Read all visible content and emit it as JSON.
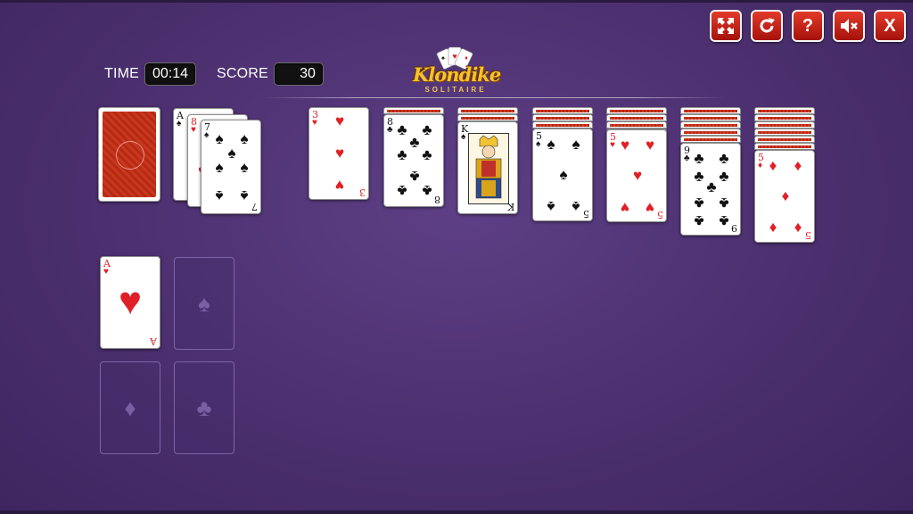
{
  "toolbar": {
    "buttons": [
      {
        "name": "fullscreen-button",
        "icon": "fullscreen-icon"
      },
      {
        "name": "restart-button",
        "icon": "restart-icon"
      },
      {
        "name": "help-button",
        "icon": "help-icon",
        "glyph": "?"
      },
      {
        "name": "mute-button",
        "icon": "sound-muted-icon"
      },
      {
        "name": "close-button",
        "icon": "close-icon",
        "glyph": "X"
      }
    ]
  },
  "hud": {
    "time_label": "TIME",
    "time_value": "00:14",
    "score_label": "SCORE",
    "score_value": "30"
  },
  "logo": {
    "title": "Klondike",
    "subtitle": "SOLITAIRE"
  },
  "stock": {
    "face_down": true
  },
  "waste": [
    {
      "rank": "A",
      "suit": "♠"
    },
    {
      "rank": "8",
      "suit": "♥"
    },
    {
      "rank": "7",
      "suit": "♠"
    }
  ],
  "tableau": [
    {
      "hidden": 0,
      "card": {
        "rank": "3",
        "suit": "♥"
      }
    },
    {
      "hidden": 1,
      "card": {
        "rank": "8",
        "suit": "♣"
      }
    },
    {
      "hidden": 2,
      "card": {
        "rank": "K",
        "suit": "♠"
      }
    },
    {
      "hidden": 3,
      "card": {
        "rank": "5",
        "suit": "♠"
      }
    },
    {
      "hidden": 4,
      "card": {
        "rank": "5",
        "suit": "♥"
      }
    },
    {
      "hidden": 5,
      "card": {
        "rank": "9",
        "suit": "♣"
      }
    },
    {
      "hidden": 6,
      "card": {
        "rank": "5",
        "suit": "♦"
      }
    }
  ],
  "foundations": [
    {
      "card": {
        "rank": "A",
        "suit": "♥"
      }
    },
    {
      "empty_suit": "♠"
    },
    {
      "empty_suit": "♦"
    },
    {
      "empty_suit": "♣"
    }
  ],
  "colors": {
    "felt": "#4b2f6e",
    "button": "#c8241a",
    "red_suit": "#e02027"
  }
}
